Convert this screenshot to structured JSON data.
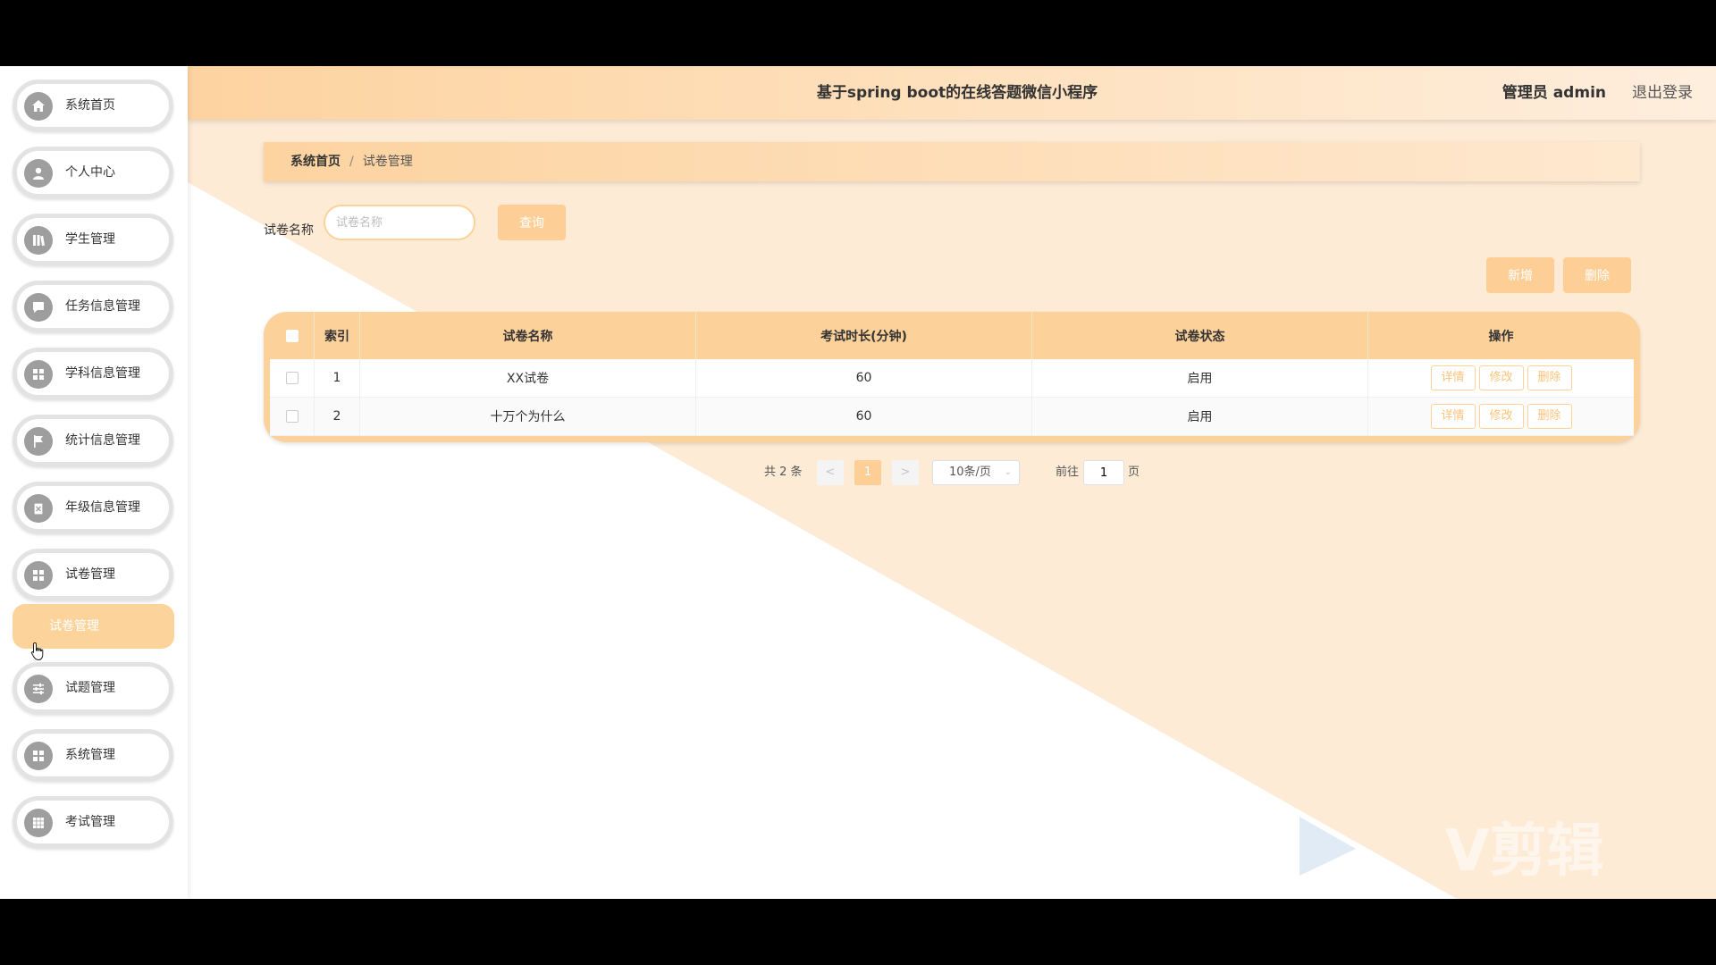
{
  "header": {
    "title": "基于spring boot的在线答题微信小程序",
    "user": "管理员 admin",
    "logout": "退出登录"
  },
  "sidebar": {
    "items": [
      {
        "label": "系统首页",
        "icon": "home-icon"
      },
      {
        "label": "个人中心",
        "icon": "user-icon"
      },
      {
        "label": "学生管理",
        "icon": "book-icon"
      },
      {
        "label": "任务信息管理",
        "icon": "chat-icon"
      },
      {
        "label": "学科信息管理",
        "icon": "grid-icon"
      },
      {
        "label": "统计信息管理",
        "icon": "flag-icon"
      },
      {
        "label": "年级信息管理",
        "icon": "clipboard-icon"
      },
      {
        "label": "试卷管理",
        "icon": "grid-icon"
      },
      {
        "label": "试题管理",
        "icon": "sliders-icon"
      },
      {
        "label": "系统管理",
        "icon": "grid-icon"
      },
      {
        "label": "考试管理",
        "icon": "table-icon"
      }
    ],
    "submenu": {
      "label": "试卷管理"
    }
  },
  "breadcrumb": {
    "home": "系统首页",
    "separator": "/",
    "current": "试卷管理"
  },
  "search": {
    "label": "试卷名称",
    "placeholder": "试卷名称",
    "value": "",
    "button": "查询"
  },
  "actions": {
    "add": "新增",
    "delete": "删除"
  },
  "table": {
    "columns": [
      "索引",
      "试卷名称",
      "考试时长(分钟)",
      "试卷状态",
      "操作"
    ],
    "rows": [
      {
        "index": "1",
        "name": "XX试卷",
        "duration": "60",
        "status": "启用"
      },
      {
        "index": "2",
        "name": "十万个为什么",
        "duration": "60",
        "status": "启用"
      }
    ],
    "row_actions": {
      "detail": "详情",
      "edit": "修改",
      "delete": "删除"
    }
  },
  "pagination": {
    "total": "共 2 条",
    "prev": "<",
    "current_page": "1",
    "next": ">",
    "page_size": "10条/页",
    "goto_label": "前往",
    "goto_value": "1",
    "page_suffix": "页"
  },
  "watermark": {
    "text": "V剪辑"
  },
  "colors": {
    "accent": "#fdcf96",
    "header_start": "#fdd3a0",
    "bg_triangle": "#fdebd6"
  }
}
